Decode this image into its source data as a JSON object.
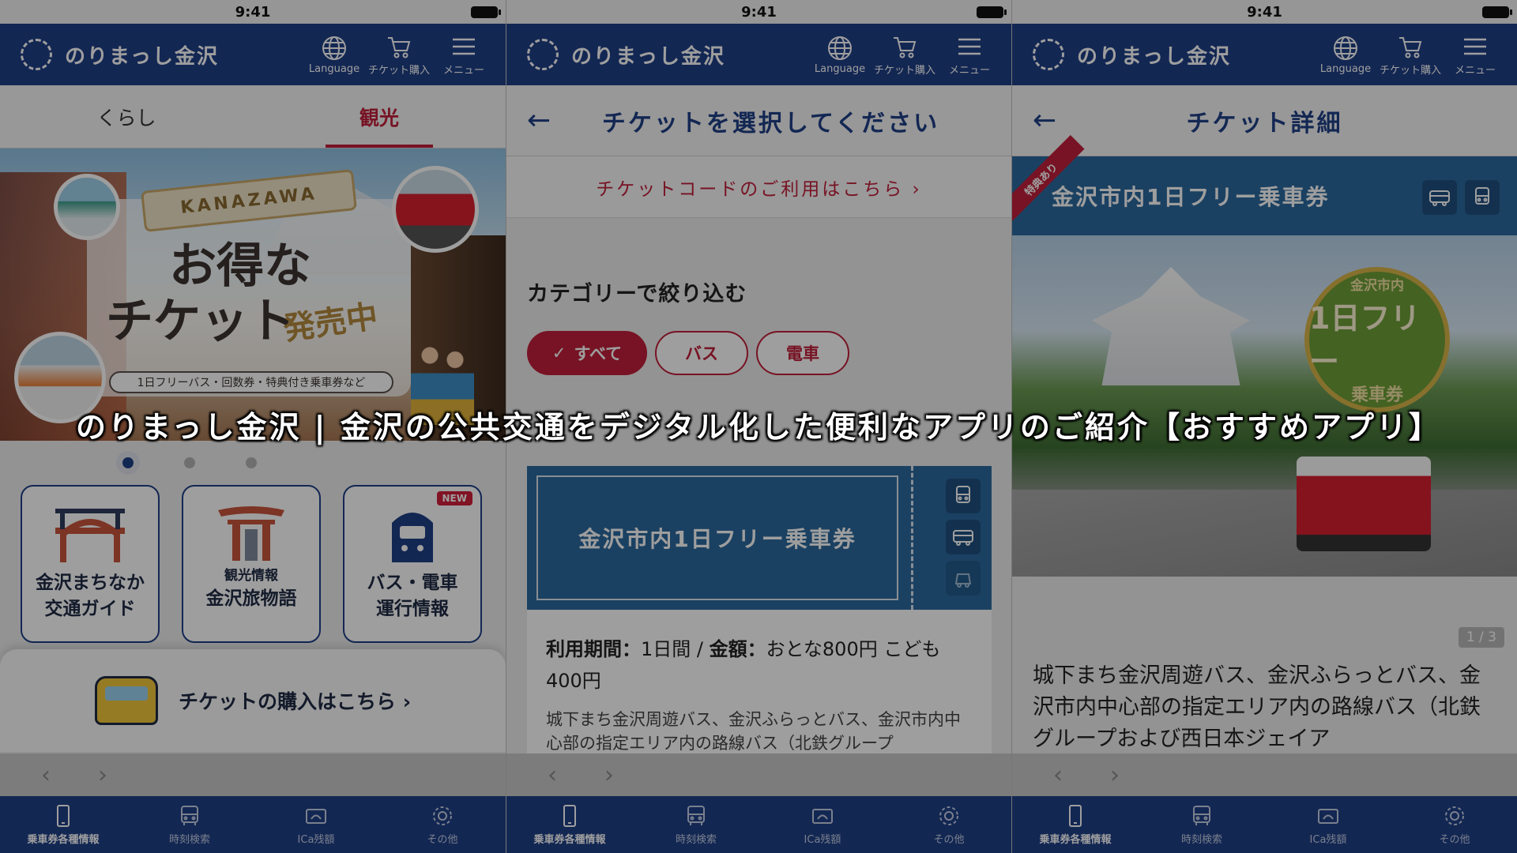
{
  "status_time": "9:41",
  "app": {
    "title": "のりまっし金沢",
    "language": "Language",
    "ticket_buy": "チケット購入",
    "menu": "メニュー"
  },
  "screen1": {
    "tabs": [
      "くらし",
      "観光"
    ],
    "active_tab": "観光",
    "hero": {
      "ribbon": "KANAZAWA",
      "line1": "お得な",
      "line2": "チケット",
      "sale": "発売中",
      "sub": "1日フリーバス・回数券・特典付き乗車券など"
    },
    "cards": [
      {
        "label1": "金沢まちなか",
        "label2": "交通ガイド"
      },
      {
        "label1": "観光情報",
        "label2": "金沢旅物語"
      },
      {
        "label1": "バス・電車",
        "label2": "運行情報",
        "badge": "NEW"
      }
    ],
    "purchase": "チケットの購入はこちら ›"
  },
  "screen2": {
    "title": "チケットを選択してください",
    "code_link": "チケットコードのご利用はこちら ›",
    "filter_title": "カテゴリーで絞り込む",
    "chips": [
      "すべて",
      "バス",
      "電車"
    ],
    "ticket_name": "金沢市内1日フリー乗車券",
    "info_line1_label1": "利用期間：",
    "info_line1_value1": "1日間",
    "info_line1_sep": " / ",
    "info_line1_label2": "金額：",
    "info_line1_value2": "おとな800円 こども400円",
    "info_desc": "城下まち金沢周遊バス、金沢ふらっとバス、金沢市内中心部の指定エリア内の路線バス（北鉄グループ"
  },
  "screen3": {
    "title": "チケット詳細",
    "tokuten": "特典あり",
    "ticket_name": "金沢市内1日フリー乗車券",
    "stamp_top": "金沢市内",
    "stamp_mid": "1日フリー",
    "stamp_bot": "乗車券",
    "page": "1 / 3",
    "desc": "城下まち金沢周遊バス、金沢ふらっとバス、金沢市内中心部の指定エリア内の路線バス（北鉄グループおよび西日本ジェイア"
  },
  "bottom_tabs": [
    "乗車券各種情報",
    "時刻検索",
    "ICa残額",
    "その他"
  ],
  "nav_arrows": [
    "‹",
    "›"
  ],
  "caption": "のりまっし金沢 | 金沢の公共交通をデジタル化した便利なアプリのご紹介【おすすめアプリ】",
  "colors": {
    "brand_navy": "#1f3f86",
    "accent_red": "#c0203a",
    "ticket_blue": "#2c6a9e"
  }
}
